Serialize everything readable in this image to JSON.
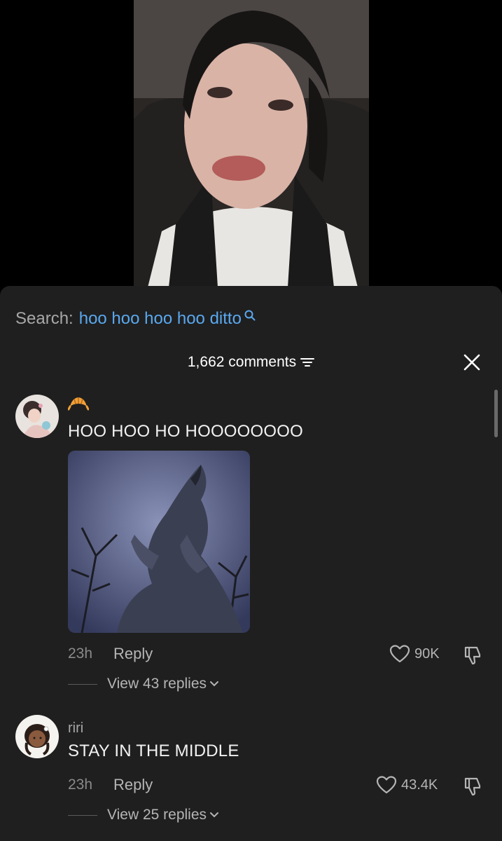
{
  "video": {
    "description_icon": "video-preview"
  },
  "search": {
    "label": "Search:",
    "query": "hoo hoo hoo hoo ditto",
    "icon": "search-icon"
  },
  "header": {
    "comment_count": "1,662 comments",
    "filter_icon": "filter-icon",
    "close_icon": "close-icon"
  },
  "comments": [
    {
      "username": "",
      "badge_icon": "croissant-icon",
      "text": "HOO HOO HO HOOOOOOOO",
      "has_image": true,
      "time": "23h",
      "reply_label": "Reply",
      "likes": "90K",
      "view_replies": "View 43 replies"
    },
    {
      "username": "riri",
      "text": "STAY IN THE MIDDLE",
      "time": "23h",
      "reply_label": "Reply",
      "likes": "43.4K",
      "view_replies": "View 25 replies"
    }
  ],
  "colors": {
    "sheet_bg": "#1f1f1f",
    "search_accent": "#5aa8ef",
    "muted_text": "#a8a8a8"
  }
}
